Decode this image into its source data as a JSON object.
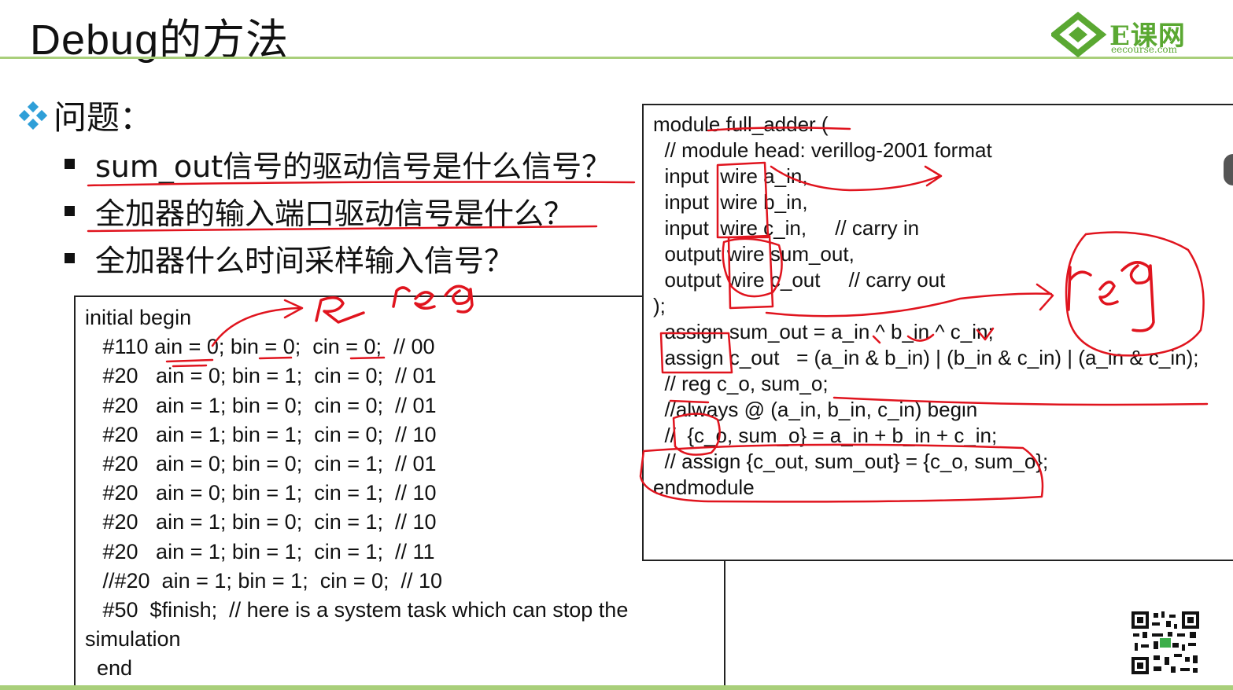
{
  "slide": {
    "title": "Debug的方法",
    "logo_text": "E课网",
    "logo_sub": "eecourse.com",
    "question_heading": "问题：",
    "bullets": [
      "sum_out信号的驱动信号是什么信号？",
      "全加器的输入端口驱动信号是什么？",
      "全加器什么时间采样输入信号？"
    ]
  },
  "testbench_code": [
    "initial begin",
    "   #110 ain = 0; bin = 0;  cin = 0;  // 00",
    "   #20   ain = 0; bin = 1;  cin = 0;  // 01",
    "   #20   ain = 1; bin = 0;  cin = 0;  // 01",
    "   #20   ain = 1; bin = 1;  cin = 0;  // 10",
    "   #20   ain = 0; bin = 0;  cin = 1;  // 01",
    "   #20   ain = 0; bin = 1;  cin = 1;  // 10",
    "   #20   ain = 1; bin = 0;  cin = 1;  // 10",
    "   #20   ain = 1; bin = 1;  cin = 1;  // 11",
    "   //#20  ain = 1; bin = 1;  cin = 0;  // 10",
    "   #50  $finish;  // here is a system task which can stop the",
    "simulation",
    "  end"
  ],
  "module_code": [
    "module full_adder (",
    "  // module head: verillog-2001 format",
    "  input  wire a_in,",
    "  input  wire b_in,",
    "  input  wire c_in,     // carry in",
    "  output wire sum_out,",
    "  output wire c_out     // carry out",
    ");",
    "",
    "  assign sum_out = a_in ^ b_in ^ c_in;",
    "  assign c_out   = (a_in & b_in) | (b_in & c_in) | (a_in & c_in);",
    "",
    "  // reg c_o, sum_o;",
    "  //always @ (a_in, b_in, c_in) begin",
    "  //  {c_o, sum_o} = a_in + b_in + c_in;",
    "  // assign {c_out, sum_out} = {c_o, sum_o};",
    "endmodule"
  ],
  "annotations": {
    "handwriting_reg_top": "reg",
    "handwriting_reg_right": "reg",
    "handwriting_R": "R"
  },
  "colors": {
    "accent_green": "#a9cf7a",
    "logo_green": "#5aa832",
    "annotation_red": "#e0141e",
    "diamond_blue": "#2f9fd8"
  }
}
